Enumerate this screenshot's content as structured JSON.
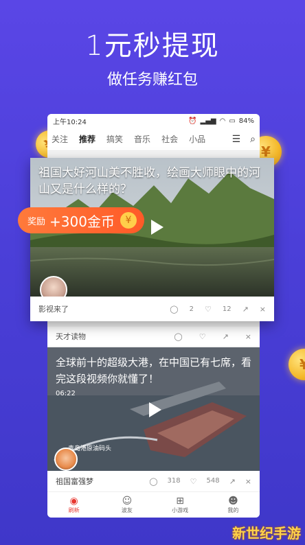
{
  "hero": {
    "title": "1元秒提现",
    "subtitle": "做任务赚红包"
  },
  "status": {
    "time": "上午10:24",
    "battery": "84%"
  },
  "tabs": [
    {
      "label": "关注"
    },
    {
      "label": "推荐"
    },
    {
      "label": "搞笑"
    },
    {
      "label": "音乐"
    },
    {
      "label": "社会"
    },
    {
      "label": "小品"
    }
  ],
  "card1": {
    "title": "祖国大好河山美不胜收，绘画大师眼中的河山又是什么样的？",
    "author": "影视来了",
    "comments": "2",
    "likes": "12"
  },
  "reward": {
    "label": "奖励",
    "amount": "+300金币",
    "icon": "¥"
  },
  "card_small": {
    "author": "天才读物"
  },
  "card2": {
    "title": "全球前十的超级大港，在中国已有七席，看完这段视频你就懂了！",
    "duration": "06:22",
    "caption": "青岛港原油码头",
    "author": "祖国富强梦",
    "comments": "318",
    "likes": "548"
  },
  "nav": [
    {
      "label": "刷新",
      "icon": "refresh-icon"
    },
    {
      "label": "波友",
      "icon": "chat-icon"
    },
    {
      "label": "小游戏",
      "icon": "gamepad-icon"
    },
    {
      "label": "我的",
      "icon": "smile-icon"
    }
  ],
  "coin_symbol": "¥",
  "watermark": "新世纪手游",
  "colors": {
    "accent": "#e8372f",
    "reward": "#ff5a28",
    "bg": "#4b3fd8"
  }
}
